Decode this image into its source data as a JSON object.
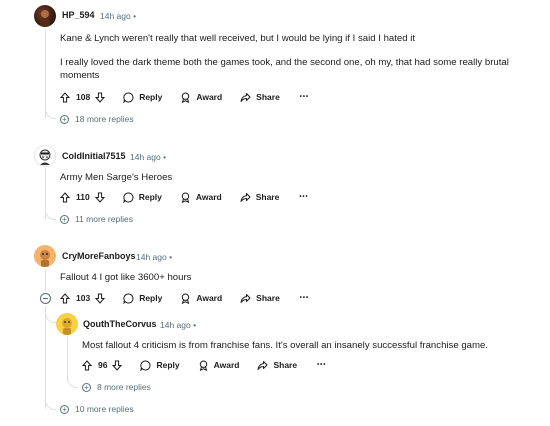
{
  "comments": [
    {
      "author": "HP_594",
      "time": "14h ago",
      "dot": "•",
      "paragraphs": [
        "Kane & Lynch weren't really that well received, but I would be lying if I said I hated it",
        "I really loved the dark theme both the games took, and the second one, oh my, that had some really brutal moments"
      ],
      "votes": "108",
      "more_replies": "18 more replies"
    },
    {
      "author": "ColdInitial7515",
      "time": "14h ago",
      "dot": "•",
      "paragraphs": [
        "Army Men Sarge's Heroes"
      ],
      "votes": "110",
      "more_replies": "11 more replies"
    },
    {
      "author": "CryMoreFanboys",
      "time": "14h ago",
      "dot": "•",
      "paragraphs": [
        "Fallout 4 I got like 3600+ hours"
      ],
      "votes": "103",
      "more_replies": "10 more replies",
      "reply": {
        "author": "QouthTheCorvus",
        "time": "14h ago",
        "dot": "•",
        "paragraphs": [
          "Most fallout 4 criticism is from franchise fans. It's overall an insanely successful franchise game."
        ],
        "votes": "96",
        "more_replies": "8 more replies"
      }
    }
  ],
  "actions": {
    "reply": "Reply",
    "award": "Award",
    "share": "Share",
    "overflow": "•••"
  },
  "colors": {
    "meta": "#576f76",
    "thread_line": "#dcdfe1"
  }
}
